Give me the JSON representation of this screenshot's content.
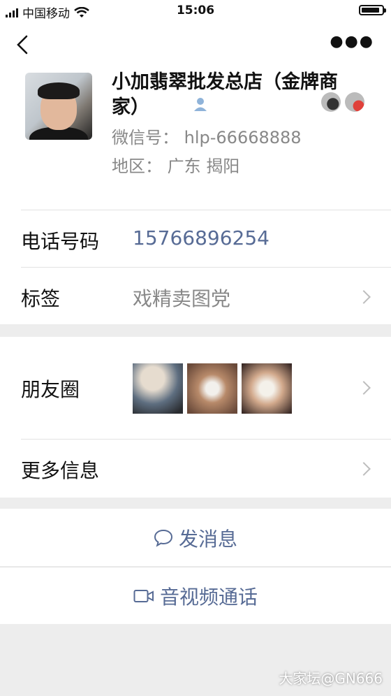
{
  "status_bar": {
    "carrier": "中国移动",
    "time": "15:06"
  },
  "profile": {
    "name": "小加翡翠批发总店（金牌商家）",
    "wechat_id": "微信号：  hlp-66668888",
    "region": "地区：  广东  揭阳"
  },
  "rows": {
    "phone": {
      "label": "电话号码",
      "value": "15766896254"
    },
    "tag": {
      "label": "标签",
      "value": "戏精卖图党"
    },
    "moments": {
      "label": "朋友圈"
    },
    "more_info": {
      "label": "更多信息"
    }
  },
  "actions": {
    "message": "发消息",
    "av_call": "音视频通话"
  },
  "watermark": "大家坛@GN666",
  "colors": {
    "link": "#576b95",
    "muted": "#888888",
    "background": "#ededed"
  },
  "icons": [
    "back-chevron-icon",
    "more-dots-icon",
    "contact-person-icon",
    "chat-bubble-icon",
    "video-camera-icon",
    "wifi-icon",
    "battery-icon"
  ]
}
